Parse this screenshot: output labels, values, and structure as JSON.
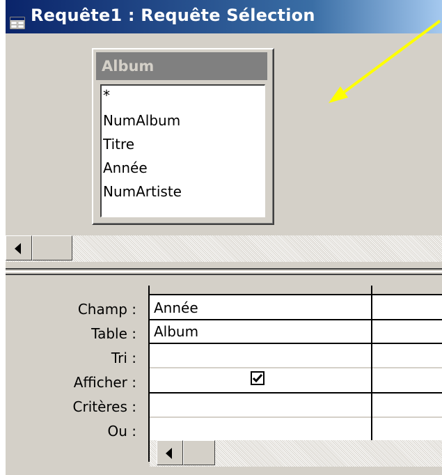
{
  "window": {
    "title": "Requête1 : Requête Sélection",
    "title_icon": "query-icon"
  },
  "table": {
    "name": "Album",
    "fields": [
      "*",
      "NumAlbum",
      "Titre",
      "Année",
      "NumArtiste"
    ]
  },
  "grid": {
    "row_labels": {
      "field": "Champ :",
      "table": "Table :",
      "sort": "Tri :",
      "show": "Afficher :",
      "criteria": "Critères :",
      "or": "Ou :"
    },
    "columns": [
      {
        "field": "Année",
        "table": "Album",
        "sort": "",
        "show": true,
        "criteria": "",
        "or": ""
      }
    ]
  },
  "annotation": {
    "color": "#ffff00"
  }
}
